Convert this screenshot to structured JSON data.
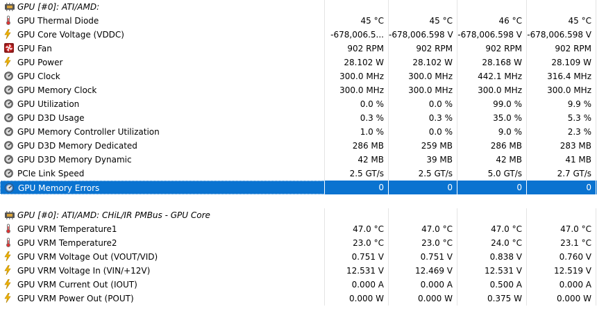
{
  "sections": [
    {
      "title": "GPU [#0]: ATI/AMD:",
      "rows": [
        {
          "label": "GPU Thermal Diode",
          "icon": "thermometer-icon",
          "values": [
            "45 °C",
            "45 °C",
            "46 °C",
            "45 °C"
          ]
        },
        {
          "label": "GPU Core Voltage (VDDC)",
          "icon": "lightning-icon",
          "values": [
            "-678,006.5...",
            "-678,006.598 V",
            "-678,006.598 V",
            "-678,006.598 V"
          ]
        },
        {
          "label": "GPU Fan",
          "icon": "fan-icon",
          "values": [
            "902 RPM",
            "902 RPM",
            "902 RPM",
            "902 RPM"
          ]
        },
        {
          "label": "GPU Power",
          "icon": "lightning-icon",
          "values": [
            "28.102 W",
            "28.102 W",
            "28.168 W",
            "28.109 W"
          ]
        },
        {
          "label": "GPU Clock",
          "icon": "gauge-icon",
          "values": [
            "300.0 MHz",
            "300.0 MHz",
            "442.1 MHz",
            "316.4 MHz"
          ]
        },
        {
          "label": "GPU Memory Clock",
          "icon": "gauge-icon",
          "values": [
            "300.0 MHz",
            "300.0 MHz",
            "300.0 MHz",
            "300.0 MHz"
          ]
        },
        {
          "label": "GPU Utilization",
          "icon": "gauge-icon",
          "values": [
            "0.0 %",
            "0.0 %",
            "99.0 %",
            "9.9 %"
          ]
        },
        {
          "label": "GPU D3D Usage",
          "icon": "gauge-icon",
          "values": [
            "0.3 %",
            "0.3 %",
            "35.0 %",
            "5.3 %"
          ]
        },
        {
          "label": "GPU Memory Controller Utilization",
          "icon": "gauge-icon",
          "values": [
            "1.0 %",
            "0.0 %",
            "9.0 %",
            "2.3 %"
          ]
        },
        {
          "label": "GPU D3D Memory Dedicated",
          "icon": "gauge-icon",
          "values": [
            "286 MB",
            "259 MB",
            "286 MB",
            "283 MB"
          ]
        },
        {
          "label": "GPU D3D Memory Dynamic",
          "icon": "gauge-icon",
          "values": [
            "42 MB",
            "39 MB",
            "42 MB",
            "41 MB"
          ]
        },
        {
          "label": "PCIe Link Speed",
          "icon": "gauge-icon",
          "values": [
            "2.5 GT/s",
            "2.5 GT/s",
            "5.0 GT/s",
            "2.7 GT/s"
          ]
        },
        {
          "label": "GPU Memory Errors",
          "icon": "gauge-icon",
          "values": [
            "0",
            "0",
            "0",
            "0"
          ],
          "selected": true
        }
      ]
    },
    {
      "title": "GPU [#0]: ATI/AMD: CHiL/IR PMBus - GPU Core",
      "rows": [
        {
          "label": "GPU VRM Temperature1",
          "icon": "thermometer-icon",
          "values": [
            "47.0 °C",
            "47.0 °C",
            "47.0 °C",
            "47.0 °C"
          ]
        },
        {
          "label": "GPU VRM Temperature2",
          "icon": "thermometer-icon",
          "values": [
            "23.0 °C",
            "23.0 °C",
            "24.0 °C",
            "23.1 °C"
          ]
        },
        {
          "label": "GPU VRM Voltage Out (VOUT/VID)",
          "icon": "lightning-icon",
          "values": [
            "0.751 V",
            "0.751 V",
            "0.838 V",
            "0.760 V"
          ]
        },
        {
          "label": "GPU VRM Voltage In (VIN/+12V)",
          "icon": "lightning-icon",
          "values": [
            "12.531 V",
            "12.469 V",
            "12.531 V",
            "12.519 V"
          ]
        },
        {
          "label": "GPU VRM Current Out (IOUT)",
          "icon": "lightning-icon",
          "values": [
            "0.000 A",
            "0.000 A",
            "0.500 A",
            "0.000 A"
          ]
        },
        {
          "label": "GPU VRM Power Out (POUT)",
          "icon": "lightning-icon",
          "values": [
            "0.000 W",
            "0.000 W",
            "0.375 W",
            "0.000 W"
          ]
        }
      ]
    }
  ],
  "colors": {
    "selection": "#0a73d0",
    "grid": "#e4e4e4",
    "bolt": "#f0b400",
    "fan": "#cc2222"
  }
}
